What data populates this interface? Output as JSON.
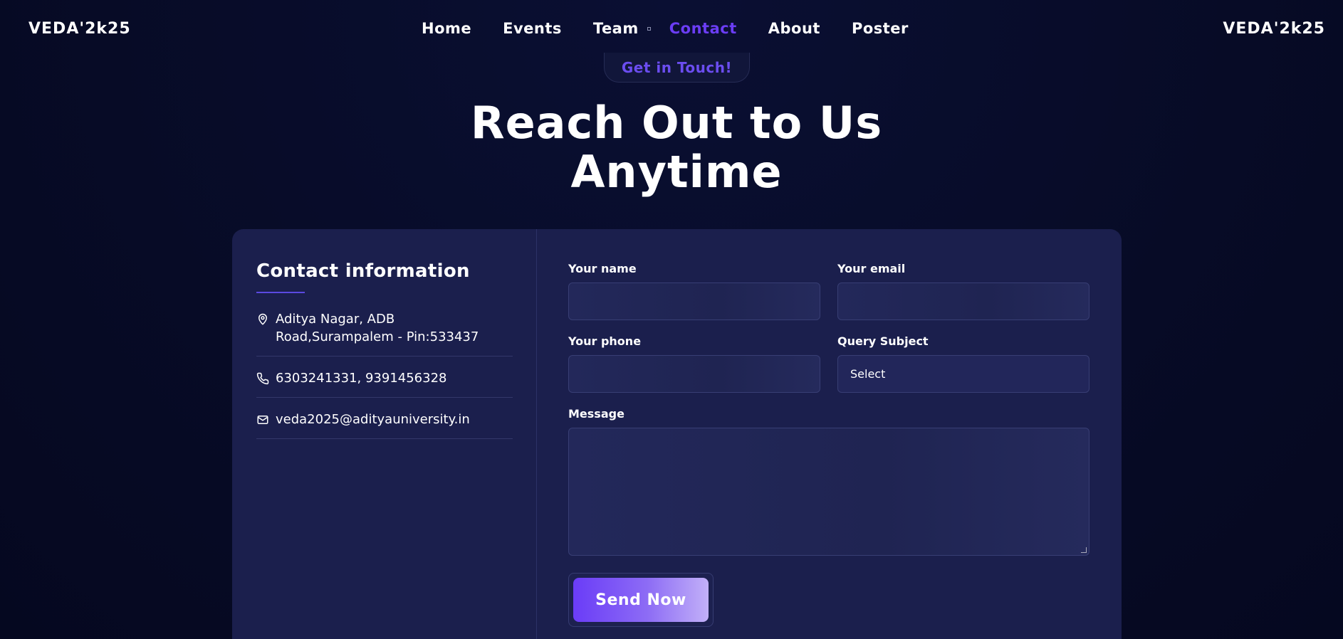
{
  "nav": {
    "brand_left": "VEDA'2k25",
    "brand_right": "VEDA'2k25",
    "items": [
      {
        "label": "Home"
      },
      {
        "label": "Events"
      },
      {
        "label": "Team"
      },
      {
        "label": "Contact"
      },
      {
        "label": "About"
      },
      {
        "label": "Poster"
      }
    ],
    "active_item": "Contact",
    "accent_color": "#6b3df5"
  },
  "hero": {
    "badge": "Get in Touch!",
    "title_line1": "Reach Out to Us",
    "title_line2": "Anytime"
  },
  "contact": {
    "heading": "Contact information",
    "address": "Aditya Nagar, ADB Road,Surampalem - Pin:533437",
    "phone": "6303241331, 9391456328",
    "email": "veda2025@adityauniversity.in",
    "icons": [
      "location-pin-icon",
      "phone-icon",
      "mail-icon"
    ]
  },
  "form": {
    "name_label": "Your name",
    "name_value": "",
    "email_label": "Your email",
    "email_value": "",
    "phone_label": "Your phone",
    "phone_value": "",
    "subject_label": "Query Subject",
    "subject_value": "Select",
    "message_label": "Message",
    "message_value": "",
    "submit_label": "Send Now"
  },
  "colors": {
    "background": "#070b26",
    "card": "#1b1f4d",
    "button_gradient_start": "#6a3cf7",
    "button_gradient_end": "#c2b0f8"
  }
}
